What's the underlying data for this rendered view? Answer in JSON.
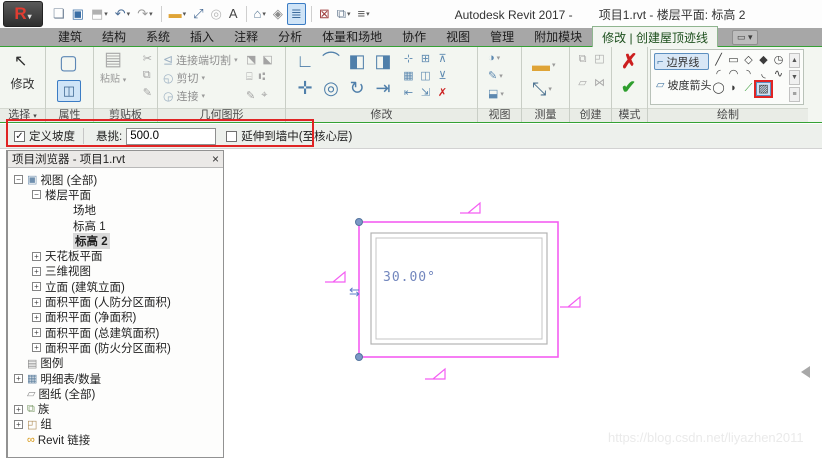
{
  "window": {
    "title_left": "Autodesk Revit 2017 -",
    "title_right": "项目1.rvt - 楼层平面: 标高 2",
    "logo": "R",
    "logo_caret": "▾"
  },
  "qat": {
    "icons": [
      {
        "name": "open-icon",
        "glyph": "❏",
        "color": "#6d7f94"
      },
      {
        "name": "save-icon",
        "glyph": "▣",
        "color": "#3a6ea5"
      },
      {
        "name": "sync-icon",
        "glyph": "⬒",
        "color": "#b0b0b0",
        "caret": true
      },
      {
        "name": "undo-icon",
        "glyph": "↶",
        "color": "#4a6d96",
        "caret": true
      },
      {
        "name": "redo-icon",
        "glyph": "↷",
        "color": "#9a9a9a",
        "caret": true
      },
      {
        "sep": true
      },
      {
        "name": "measure-icon",
        "glyph": "▬",
        "color": "#dfa437",
        "caret": true
      },
      {
        "name": "aligned-dimension-icon",
        "glyph": "⤢",
        "color": "#4a6d96"
      },
      {
        "name": "tag-icon",
        "glyph": "◎",
        "color": "#b8b8b8"
      },
      {
        "name": "text-icon",
        "glyph": "A",
        "color": "#444444"
      },
      {
        "sep": true
      },
      {
        "name": "default-3d-view-icon",
        "glyph": "⌂",
        "color": "#5f7d99",
        "caret": true
      },
      {
        "name": "section-icon",
        "glyph": "◈",
        "color": "#8a8a8a"
      },
      {
        "name": "thin-lines-icon",
        "glyph": "≣",
        "color": "#3c6c9c",
        "active": true
      },
      {
        "sep": true
      },
      {
        "name": "close-hidden-windows-icon",
        "glyph": "⊠",
        "color": "#a04040"
      },
      {
        "name": "switch-windows-icon",
        "glyph": "⧉",
        "color": "#6d7f94",
        "caret": true
      },
      {
        "name": "customize-qat-icon",
        "glyph": "≡",
        "color": "#555555",
        "caret": true
      }
    ]
  },
  "tabs": {
    "items": [
      "建筑",
      "结构",
      "系统",
      "插入",
      "注释",
      "分析",
      "体量和场地",
      "协作",
      "视图",
      "管理",
      "附加模块"
    ],
    "contextual": "修改 | 创建屋顶迹线",
    "panel_toggle_glyph": "▭ ▾"
  },
  "ribbon": {
    "select_panel": {
      "label": "选择",
      "caret": "▾",
      "modify_button": "修改",
      "cursor_glyph": "↖"
    },
    "properties_panel": {
      "label": "属性",
      "properties_glyph": "▢",
      "type_glyph": "◫"
    },
    "clipboard_panel": {
      "label": "剪贴板",
      "paste_label": "粘贴",
      "paste_glyph": "▤",
      "paste_caret": "▾",
      "mini_icons": [
        {
          "name": "cut-icon",
          "glyph": "✂"
        },
        {
          "name": "copy-icon",
          "glyph": "⧉"
        },
        {
          "name": "match-properties-icon",
          "glyph": "✎"
        }
      ]
    },
    "geometry_panel": {
      "label": "几何图形",
      "rows": [
        {
          "name": "cope-button",
          "glyph": "⊴",
          "label": "连接端切割",
          "caret": "▾"
        },
        {
          "name": "cut-geometry-button",
          "glyph": "◵",
          "label": "剪切",
          "caret": "▾"
        },
        {
          "name": "join-geometry-button",
          "glyph": "◶",
          "label": "连接",
          "caret": "▾"
        }
      ],
      "mini_icons": [
        {
          "name": "wall-joins-icon",
          "glyph": "⬔"
        },
        {
          "name": "beam-joins-icon",
          "glyph": "⬕"
        },
        {
          "name": "unjoin-icon",
          "glyph": "⌸"
        },
        {
          "name": "split-face-icon",
          "glyph": "⑆"
        },
        {
          "name": "paint-icon",
          "glyph": "✎"
        },
        {
          "name": "demolish-icon",
          "glyph": "⌖"
        }
      ]
    },
    "modify_panel": {
      "label": "修改",
      "big_icons": [
        {
          "name": "align-icon",
          "glyph": "∟"
        },
        {
          "name": "offset-icon",
          "glyph": "⌒"
        },
        {
          "name": "mirror-axis-icon",
          "glyph": "◧"
        },
        {
          "name": "mirror-draw-icon",
          "glyph": "◨"
        },
        {
          "name": "move-icon",
          "glyph": "✛"
        },
        {
          "name": "copy-icon",
          "glyph": "◎"
        },
        {
          "name": "rotate-icon",
          "glyph": "↻"
        },
        {
          "name": "trim-extend-icon",
          "glyph": "⇥"
        }
      ],
      "small_icons": [
        {
          "name": "split-element-icon",
          "glyph": "⊹"
        },
        {
          "name": "split-gap-icon",
          "glyph": "⊞"
        },
        {
          "name": "pin-icon",
          "glyph": "⊼"
        },
        {
          "name": "array-icon",
          "glyph": "▦"
        },
        {
          "name": "scale-icon",
          "glyph": "◫"
        },
        {
          "name": "unpin-icon",
          "glyph": "⊻"
        },
        {
          "name": "trim-corner-icon",
          "glyph": "⇤"
        },
        {
          "name": "trim-multi-icon",
          "glyph": "⇲"
        },
        {
          "name": "delete-icon",
          "glyph": "✗",
          "color": "#cc1f1f"
        }
      ]
    },
    "view_panel": {
      "label": "视图",
      "rows": [
        {
          "name": "temporary-hide-icon",
          "glyph": "◑"
        },
        {
          "name": "override-graphics-icon",
          "glyph": "✎"
        },
        {
          "name": "hide-icon",
          "glyph": "⬓"
        }
      ]
    },
    "measure_panel": {
      "label": "测量",
      "rows": [
        {
          "name": "measure-icon",
          "glyph": "▬",
          "color": "#dfa437"
        },
        {
          "name": "dimension-icon",
          "glyph": "⤡",
          "color": "#4a708f"
        }
      ]
    },
    "create_panel": {
      "label": "创建",
      "icons": [
        {
          "name": "create-group-icon",
          "glyph": "⧉"
        },
        {
          "name": "create-similar-icon",
          "glyph": "◰"
        },
        {
          "name": "create-assembly-icon",
          "glyph": "▱"
        },
        {
          "name": "create-parts-icon",
          "glyph": "⋈"
        }
      ]
    },
    "mode_panel": {
      "label": "模式",
      "cancel_glyph": "✗",
      "finish_glyph": "✔"
    },
    "draw_panel": {
      "label": "绘制",
      "buttons": [
        {
          "name": "boundary-line-button",
          "glyph": "⌐",
          "label": "边界线",
          "active": true
        },
        {
          "name": "slope-arrow-button",
          "glyph": "▱",
          "label": "坡度箭头",
          "active": false
        }
      ],
      "grid": [
        {
          "name": "draw-line-icon",
          "glyph": "╱"
        },
        {
          "name": "draw-rectangle-icon",
          "glyph": "▭"
        },
        {
          "name": "draw-inscribed-polygon-icon",
          "glyph": "◇"
        },
        {
          "name": "draw-circumscribed-polygon-icon",
          "glyph": "◆"
        },
        {
          "name": "draw-circle-icon",
          "glyph": "◷"
        },
        {
          "name": "draw-arc-start-end-icon",
          "glyph": "◜"
        },
        {
          "name": "draw-arc-center-icon",
          "glyph": "◠"
        },
        {
          "name": "draw-arc-tangent-icon",
          "glyph": "◝"
        },
        {
          "name": "draw-arc-fillet-icon",
          "glyph": "◟"
        },
        {
          "name": "draw-spline-icon",
          "glyph": "∿"
        },
        {
          "name": "draw-ellipse-icon",
          "glyph": "◯"
        },
        {
          "name": "draw-partial-ellipse-icon",
          "glyph": "◗"
        },
        {
          "name": "pick-lines-icon",
          "glyph": "⟋",
          "green": true
        },
        {
          "name": "pick-walls-icon",
          "glyph": "▨",
          "picked": true
        }
      ],
      "scroll": [
        {
          "name": "draw-scroll-up-icon",
          "glyph": "▲"
        },
        {
          "name": "draw-scroll-down-icon",
          "glyph": "▼"
        },
        {
          "name": "draw-expand-icon",
          "glyph": "≡"
        }
      ]
    }
  },
  "options_bar": {
    "define_slope_label": "定义坡度",
    "define_slope_checked": "✓",
    "overhang_label": "悬挑:",
    "overhang_value": "500.0",
    "extend_label": "延伸到墙中(至核心层)"
  },
  "project_browser": {
    "title": "项目浏览器 - 项目1.rvt",
    "close_glyph": "×",
    "tree": [
      {
        "label": "视图 (全部)",
        "level": 0,
        "exp": "minus",
        "icon": "▣",
        "icon_color": "#6f8fae"
      },
      {
        "label": "楼层平面",
        "level": 1,
        "exp": "minus"
      },
      {
        "label": "场地",
        "level": 2,
        "exp": "none"
      },
      {
        "label": "标高 1",
        "level": 2,
        "exp": "none"
      },
      {
        "label": "标高 2",
        "level": 2,
        "exp": "none",
        "bold": true
      },
      {
        "label": "天花板平面",
        "level": 1,
        "exp": "plus"
      },
      {
        "label": "三维视图",
        "level": 1,
        "exp": "plus"
      },
      {
        "label": "立面 (建筑立面)",
        "level": 1,
        "exp": "plus"
      },
      {
        "label": "面积平面 (人防分区面积)",
        "level": 1,
        "exp": "plus"
      },
      {
        "label": "面积平面 (净面积)",
        "level": 1,
        "exp": "plus"
      },
      {
        "label": "面积平面 (总建筑面积)",
        "level": 1,
        "exp": "plus"
      },
      {
        "label": "面积平面 (防火分区面积)",
        "level": 1,
        "exp": "plus"
      },
      {
        "label": "图例",
        "level": 0,
        "exp": "none",
        "icon": "▤",
        "icon_color": "#8b8b8b"
      },
      {
        "label": "明细表/数量",
        "level": 0,
        "exp": "plus",
        "icon": "▦",
        "icon_color": "#5d7f9e"
      },
      {
        "label": "图纸 (全部)",
        "level": 0,
        "exp": "none",
        "icon": "▱",
        "icon_color": "#8b8b8b"
      },
      {
        "label": "族",
        "level": 0,
        "exp": "plus",
        "icon": "⧉",
        "icon_color": "#7d9b6a"
      },
      {
        "label": "组",
        "level": 0,
        "exp": "plus",
        "icon": "◰",
        "icon_color": "#b08d57"
      },
      {
        "label": "Revit 链接",
        "level": 0,
        "exp": "none",
        "icon": "∞",
        "icon_color": "#d4920a"
      }
    ]
  },
  "canvas": {
    "angle_label": "30.00°",
    "watermark": "https://blog.csdn.net/liyazhen2011"
  },
  "colors": {
    "sketch_magenta": "#f45ef2",
    "wall_gray": "#b3b3b3",
    "dim_blue": "#7286bd",
    "endpoint_blue": "#7b98c6",
    "annotation_red": "#e02424",
    "accent_green": "#35a135",
    "tabbar_gray": "#a7a7a7"
  }
}
